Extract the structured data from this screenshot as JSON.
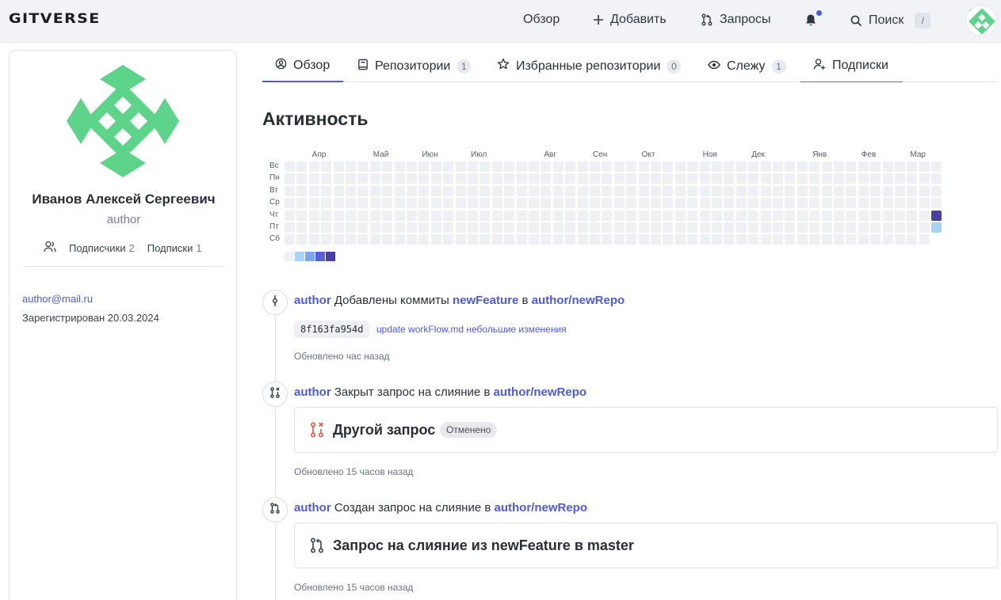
{
  "header": {
    "logo": "GITVERSE",
    "nav": {
      "overview": "Обзор",
      "add": "Добавить",
      "requests": "Запросы",
      "search": "Поиск",
      "search_shortcut": "/"
    }
  },
  "profile": {
    "full_name": "Иванов Алексей Сергеевич",
    "login": "author",
    "followers_label": "Подписчики",
    "followers_count": "2",
    "following_label": "Подписки",
    "following_count": "1",
    "email": "author@mail.ru",
    "registered": "Зарегистрирован 20.03.2024"
  },
  "tabs": [
    {
      "label": "Обзор",
      "icon": "user-circle-icon",
      "active": true
    },
    {
      "label": "Репозитории",
      "count": "1",
      "icon": "book-icon"
    },
    {
      "label": "Избранные репозитории",
      "count": "0",
      "icon": "star-icon"
    },
    {
      "label": "Слежу",
      "count": "1",
      "icon": "eye-icon"
    },
    {
      "label": "Подписки",
      "icon": "user-plus-icon"
    }
  ],
  "activity": {
    "title": "Активность",
    "months": [
      "Апр",
      "Май",
      "Июн",
      "Июл",
      "Авг",
      "Сен",
      "Окт",
      "Ноя",
      "Дек",
      "Янв",
      "Фев",
      "Мар"
    ],
    "weekdays": [
      "Вс",
      "Пн",
      "Вт",
      "Ср",
      "Чт",
      "Пт",
      "Сб"
    ],
    "active_days": [
      {
        "week": 53,
        "day": 4,
        "level": 4
      },
      {
        "week": 53,
        "day": 5,
        "level": 1
      }
    ],
    "legend_colors": [
      "#eef0f3",
      "#a6d4f5",
      "#7ba9ee",
      "#5661d8",
      "#4b3fa3"
    ]
  },
  "events": [
    {
      "user": "author",
      "action": "Добавлены коммиты",
      "branch": "newFeature",
      "preposition": "в",
      "repo": "author/newRepo",
      "commit_sha": "8f163fa954d",
      "commit_message": "update workFlow.md небольшие изменения",
      "updated": "Обновлено час назад"
    },
    {
      "user": "author",
      "action": "Закрыт запрос на слияние в",
      "repo": "author/newRepo",
      "card_title": "Другой запрос",
      "status": "Отменено",
      "updated": "Обновлено 15 часов назад"
    },
    {
      "user": "author",
      "action": "Создан запрос на слияние в",
      "repo": "author/newRepo",
      "card_title": "Запрос на слияние из newFeature в master",
      "updated": "Обновлено 15 часов назад"
    }
  ],
  "colors": {
    "accent": "#4f5bd5",
    "avatar_green": "#5ed38a",
    "closed_pr_red": "#e0533d"
  }
}
